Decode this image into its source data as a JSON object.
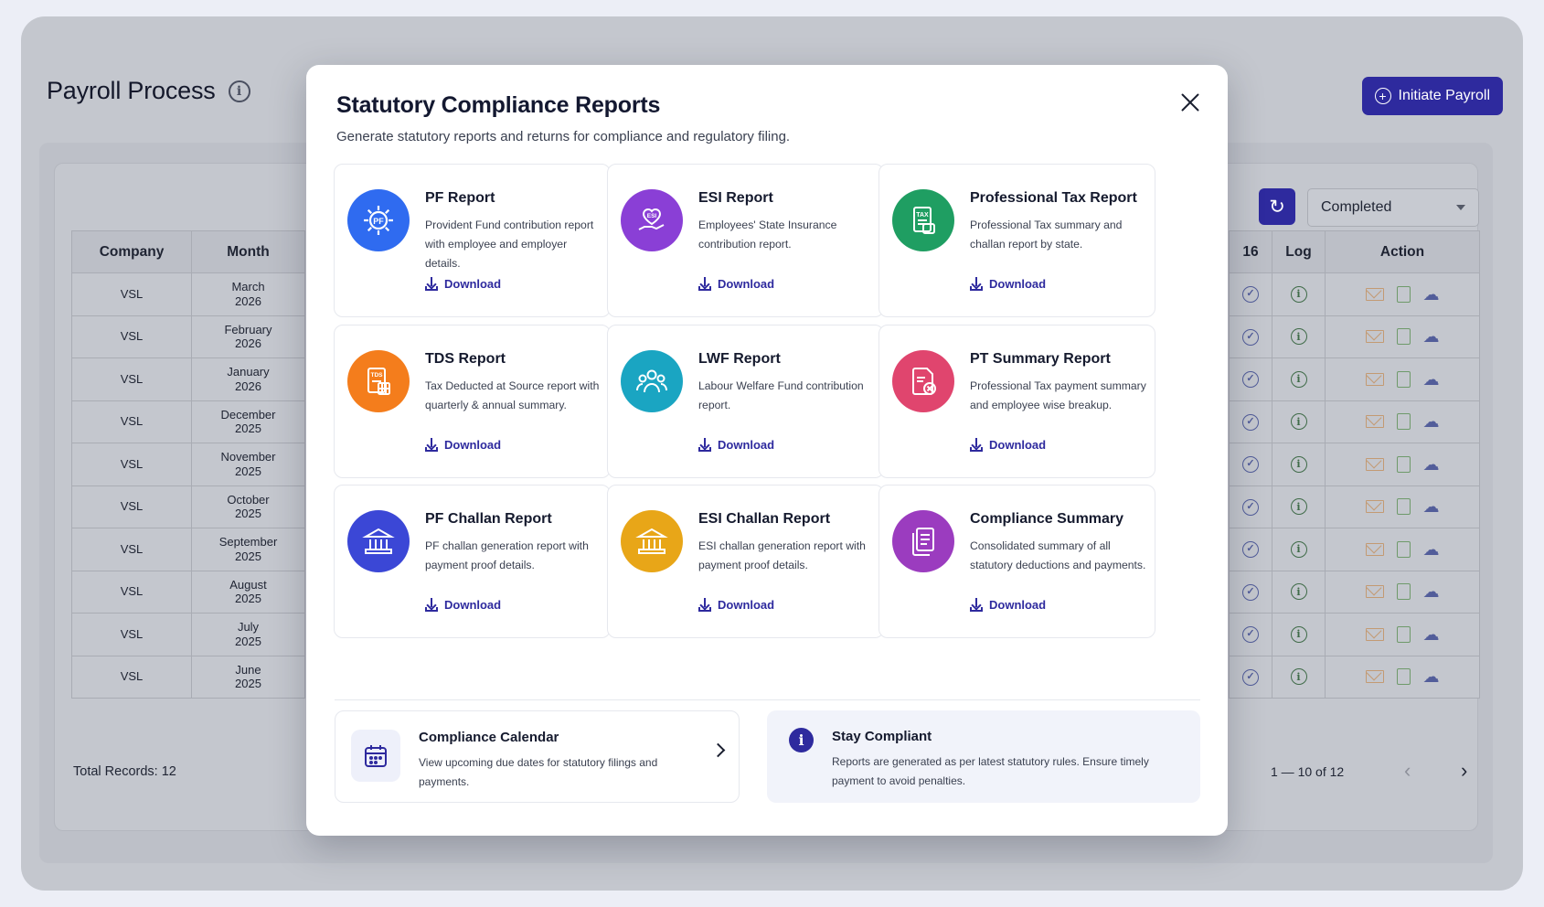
{
  "page": {
    "title": "Payroll Process",
    "initiate_label": "Initiate Payroll",
    "status_filter": "Completed",
    "total_records": "Total Records: 12",
    "pagination": "1 — 10 of 12"
  },
  "table": {
    "left_headers": [
      "Company",
      "Month"
    ],
    "right_headers": [
      "16",
      "Log",
      "Action"
    ],
    "rows": [
      {
        "company": "VSL",
        "month": "March",
        "year": "2026"
      },
      {
        "company": "VSL",
        "month": "February",
        "year": "2026"
      },
      {
        "company": "VSL",
        "month": "January",
        "year": "2026"
      },
      {
        "company": "VSL",
        "month": "December",
        "year": "2025"
      },
      {
        "company": "VSL",
        "month": "November",
        "year": "2025"
      },
      {
        "company": "VSL",
        "month": "October",
        "year": "2025"
      },
      {
        "company": "VSL",
        "month": "September",
        "year": "2025"
      },
      {
        "company": "VSL",
        "month": "August",
        "year": "2025"
      },
      {
        "company": "VSL",
        "month": "July",
        "year": "2025"
      },
      {
        "company": "VSL",
        "month": "June",
        "year": "2025"
      }
    ]
  },
  "modal": {
    "title": "Statutory Compliance Reports",
    "subtitle": "Generate statutory reports and returns for compliance and regulatory filing.",
    "download_label": "Download",
    "reports": [
      {
        "title": "PF Report",
        "desc": "Provident Fund contribution report with employee and employer details.",
        "icon": "pf-gear-icon",
        "color": "#2f6bf0"
      },
      {
        "title": "ESI Report",
        "desc": "Employees' State Insurance contribution report.",
        "icon": "esi-heart-hand-icon",
        "color": "#8a3fd6"
      },
      {
        "title": "Professional Tax Report",
        "desc": "Professional Tax summary and challan report by state.",
        "icon": "tax-document-icon",
        "color": "#1f9e62"
      },
      {
        "title": "TDS Report",
        "desc": "Tax Deducted at Source report with quarterly & annual summary.",
        "icon": "tds-calculator-icon",
        "color": "#f47d1c"
      },
      {
        "title": "LWF Report",
        "desc": "Labour Welfare Fund contribution report.",
        "icon": "people-group-icon",
        "color": "#1aa5c2"
      },
      {
        "title": "PT Summary Report",
        "desc": "Professional Tax payment summary and employee wise breakup.",
        "icon": "document-x-icon",
        "color": "#e0456e"
      },
      {
        "title": "PF Challan Report",
        "desc": "PF challan generation report with payment proof details.",
        "icon": "bank-building-icon",
        "color": "#3b47d6"
      },
      {
        "title": "ESI Challan Report",
        "desc": "ESI challan generation report with payment proof details.",
        "icon": "bank-building-icon",
        "color": "#e8a618"
      },
      {
        "title": "Compliance Summary",
        "desc": "Consolidated summary of all statutory deductions and payments.",
        "icon": "stacked-documents-icon",
        "color": "#9b3cbf"
      }
    ],
    "calendar": {
      "title": "Compliance Calendar",
      "desc": "View upcoming due dates for statutory filings and payments."
    },
    "compliant": {
      "title": "Stay Compliant",
      "desc": "Reports are generated as per latest statutory rules. Ensure timely payment to avoid penalties."
    }
  }
}
